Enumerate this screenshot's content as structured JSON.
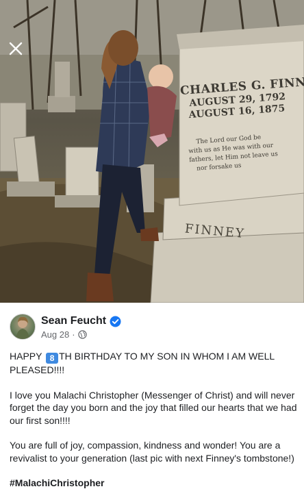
{
  "post": {
    "photo_alt": "",
    "tombstone": {
      "line1": "CHARLES G. FINNEY",
      "line2": "AUGUST 29, 1792",
      "line3": "AUGUST 16, 1875",
      "verse": [
        "The Lord our God be",
        "with us as He was with our",
        "fathers, let Him not leave us",
        "nor forsake us"
      ],
      "base_name": "FINNEY"
    },
    "author": {
      "name": "Sean Feucht",
      "verified": true,
      "date": "Aug 28",
      "separator": "·",
      "audience_icon": "globe-icon"
    },
    "text": {
      "line1_before": "HAPPY ",
      "keycap": "8",
      "line1_after": "TH BIRTHDAY TO MY SON IN WHOM I AM WELL PLEASED!!!!",
      "para2": "I love you Malachi Christopher (Messenger of Christ) and will never forget the day you born and the joy that filled our hearts that we had our first son!!!!",
      "para3": "You are full of joy, compassion, kindness and wonder! You are a revivalist to your generation (last pic with next Finney's tombstone!)",
      "hashtag": "#MalachiChristopher"
    }
  },
  "ui": {
    "close_icon": "close-icon",
    "accent_color": "#1877f2",
    "keycap_color": "#3f8ae0"
  }
}
